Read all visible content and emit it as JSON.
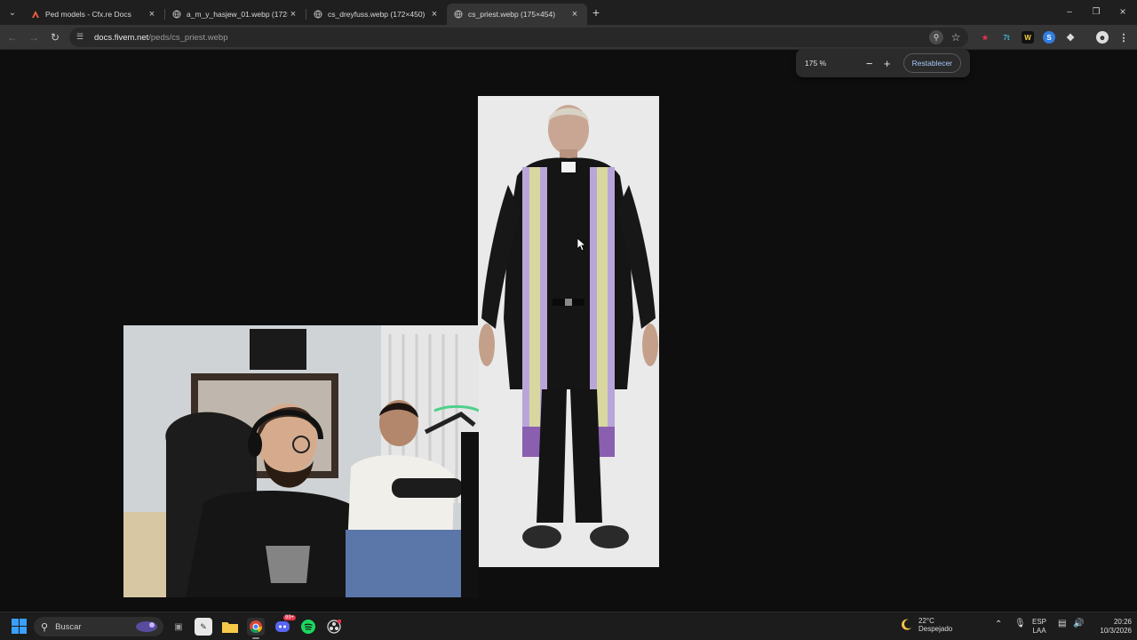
{
  "browser": {
    "tabs": [
      {
        "title": "Ped models - Cfx.re Docs",
        "active": false
      },
      {
        "title": "a_m_y_hasjew_01.webp (172×4",
        "active": false
      },
      {
        "title": "cs_dreyfuss.webp (172×450)",
        "active": false
      },
      {
        "title": "cs_priest.webp (175×454)",
        "active": true
      }
    ],
    "url_host": "docs.fivem.net",
    "url_path": "/peds/cs_priest.webp",
    "zoom": {
      "level": "175 %",
      "minus": "−",
      "plus": "+",
      "reset_label": "Restablecer"
    }
  },
  "taskbar": {
    "search_placeholder": "Buscar",
    "discord_badge": "99+",
    "weather_temp": "22°C",
    "weather_desc": "Despejado",
    "lang_top": "ESP",
    "lang_bottom": "LAA",
    "time": "20:26",
    "date": "10/3/2026"
  },
  "colors": {
    "accent": "#a8c7fa",
    "tab_active": "#353535",
    "page_bg": "#0e0e0e"
  }
}
